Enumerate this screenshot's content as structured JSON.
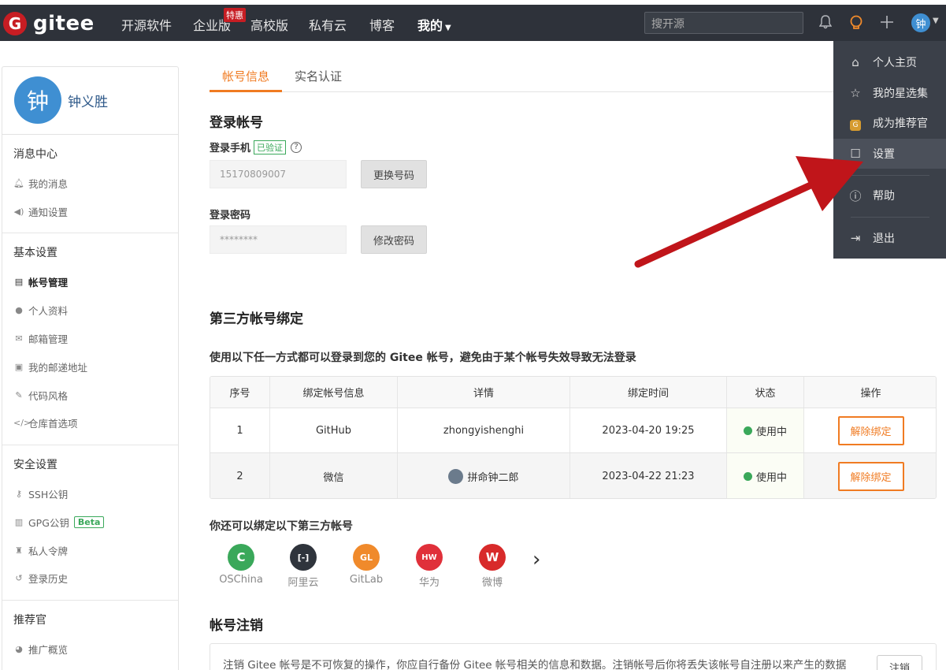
{
  "nav": {
    "logo_text": "gitee",
    "logo_letter": "G",
    "items": [
      "开源软件",
      "企业版",
      "高校版",
      "私有云",
      "博客"
    ],
    "badge": "特惠",
    "mine": "我的",
    "search_placeholder": "搜开源",
    "avatar": "钟"
  },
  "dropdown": {
    "items": [
      {
        "label": "个人主页",
        "icon": "home-icon"
      },
      {
        "label": "我的星选集",
        "icon": "star-icon"
      },
      {
        "label": "成为推荐官",
        "icon": "gem-icon"
      },
      {
        "label": "设置",
        "icon": "edit-icon"
      },
      {
        "label": "帮助",
        "icon": "help-icon"
      },
      {
        "label": "退出",
        "icon": "logout-icon"
      }
    ],
    "gem_letter": "G"
  },
  "profile": {
    "avatar": "钟",
    "name": "钟义胜"
  },
  "sidebar": {
    "groups": [
      {
        "title": "消息中心",
        "items": [
          "我的消息",
          "通知设置"
        ]
      },
      {
        "title": "基本设置",
        "items": [
          "帐号管理",
          "个人资料",
          "邮箱管理",
          "我的邮递地址",
          "代码风格",
          "仓库首选项"
        ]
      },
      {
        "title": "安全设置",
        "items": [
          "SSH公钥",
          "GPG公钥",
          "私人令牌",
          "登录历史"
        ]
      },
      {
        "title": "推荐官",
        "items": [
          "推广概览"
        ]
      }
    ],
    "beta": "Beta"
  },
  "tabs": [
    "帐号信息",
    "实名认证"
  ],
  "login": {
    "title": "登录帐号",
    "phone_label": "登录手机",
    "verified": "已验证",
    "help": "?",
    "phone_value": "15170809007",
    "change_phone": "更换号码",
    "password_label": "登录密码",
    "password_value": "********",
    "change_password": "修改密码"
  },
  "third_party": {
    "title": "第三方帐号绑定",
    "desc": "使用以下任一方式都可以登录到您的 Gitee 帐号，避免由于某个帐号失效导致无法登录",
    "headers": [
      "序号",
      "绑定帐号信息",
      "详情",
      "绑定时间",
      "状态",
      "操作"
    ],
    "rows": [
      {
        "no": "1",
        "account": "GitHub",
        "detail": "zhongyishenghi",
        "time": "2023-04-20 19:25",
        "status": "使用中",
        "action": "解除绑定"
      },
      {
        "no": "2",
        "account": "微信",
        "detail": "拼命钟二郎",
        "time": "2023-04-22 21:23",
        "status": "使用中",
        "action": "解除绑定"
      }
    ],
    "more_title": "你还可以绑定以下第三方帐号",
    "providers": [
      {
        "name": "OSChina",
        "color": "#3aa85a",
        "glyph": "C"
      },
      {
        "name": "阿里云",
        "color": "#2f343c",
        "glyph": "[-]"
      },
      {
        "name": "GitLab",
        "color": "#f08a2b",
        "glyph": "GL"
      },
      {
        "name": "华为",
        "color": "#e0303a",
        "glyph": "HW"
      },
      {
        "name": "微博",
        "color": "#d82a2a",
        "glyph": "W"
      }
    ],
    "next": "›"
  },
  "cancel": {
    "title": "帐号注销",
    "text": "注销 Gitee 帐号是不可恢复的操作，你应自行备份 Gitee 帐号相关的信息和数据。注销帐号后你将丢失该帐号自注册以来产生的数据",
    "button": "注销"
  },
  "colors": {
    "accent": "#f07b22",
    "nav_bg": "#2e323a",
    "success": "#3aa85a",
    "arrow": "#c0151a"
  }
}
